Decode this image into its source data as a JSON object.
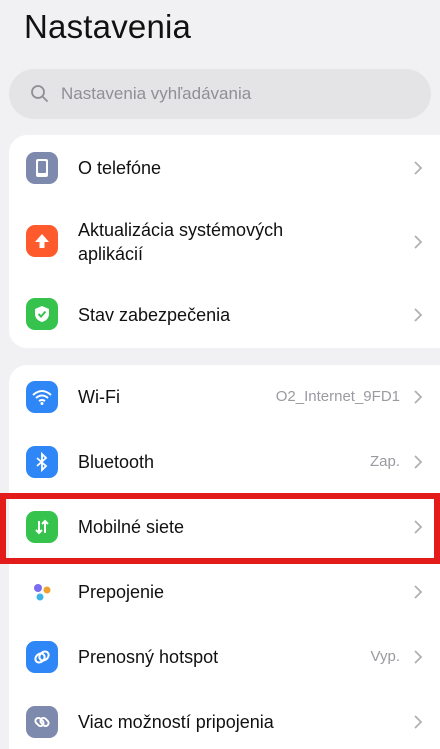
{
  "header": {
    "title": "Nastavenia"
  },
  "search": {
    "placeholder": "Nastavenia vyhľadávania"
  },
  "group1": {
    "items": [
      {
        "label": "O telefóne"
      },
      {
        "label": "Aktualizácia systémových aplikácií"
      },
      {
        "label": "Stav zabezpečenia"
      }
    ]
  },
  "group2": {
    "items": [
      {
        "label": "Wi-Fi",
        "value": "O2_Internet_9FD1"
      },
      {
        "label": "Bluetooth",
        "value": "Zap."
      },
      {
        "label": "Mobilné siete"
      },
      {
        "label": "Prepojenie"
      },
      {
        "label": "Prenosný hotspot",
        "value": "Vyp."
      },
      {
        "label": "Viac možností pripojenia"
      }
    ]
  },
  "colors": {
    "highlight": "#e31b1b",
    "phone_icon": "#7d89ad",
    "update_icon": "#ff5a2b",
    "security_icon": "#35c24d",
    "wifi_icon": "#2f86f6",
    "bluetooth_icon": "#2f86f6",
    "mobile_icon": "#35c24d",
    "hotspot_icon": "#2f86f6",
    "more_icon": "#7d89ad"
  }
}
